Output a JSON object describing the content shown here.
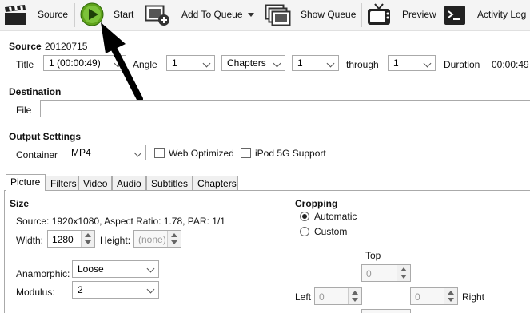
{
  "toolbar": {
    "source_label": "Source",
    "start_label": "Start",
    "add_to_queue_label": "Add To Queue",
    "show_queue_label": "Show Queue",
    "preview_label": "Preview",
    "activity_log_label": "Activity Log"
  },
  "source": {
    "heading": "Source",
    "name": "20120715",
    "title_label": "Title",
    "title_value": "1 (00:00:49)",
    "angle_label": "Angle",
    "angle_value": "1",
    "range_type_value": "Chapters",
    "range_start_value": "1",
    "through_label": "through",
    "range_end_value": "1",
    "duration_label": "Duration",
    "duration_value": "00:00:49"
  },
  "destination": {
    "heading": "Destination",
    "file_label": "File",
    "file_value": ""
  },
  "output_settings": {
    "heading": "Output Settings",
    "container_label": "Container",
    "container_value": "MP4",
    "web_optimized_label": "Web Optimized",
    "ipod_label": "iPod 5G Support"
  },
  "tabs": [
    "Picture",
    "Filters",
    "Video",
    "Audio",
    "Subtitles",
    "Chapters"
  ],
  "picture": {
    "size_heading": "Size",
    "source_info": "Source:  1920x1080, Aspect Ratio: 1.78, PAR: 1/1",
    "width_label": "Width:",
    "width_value": "1280",
    "height_label": "Height:",
    "height_value": "(none)",
    "anamorphic_label": "Anamorphic:",
    "anamorphic_value": "Loose",
    "modulus_label": "Modulus:",
    "modulus_value": "2",
    "cropping_heading": "Cropping",
    "automatic_label": "Automatic",
    "custom_label": "Custom",
    "top_label": "Top",
    "top_value": "0",
    "left_label": "Left",
    "left_value": "0",
    "right_label": "Right",
    "right_value": "0"
  }
}
